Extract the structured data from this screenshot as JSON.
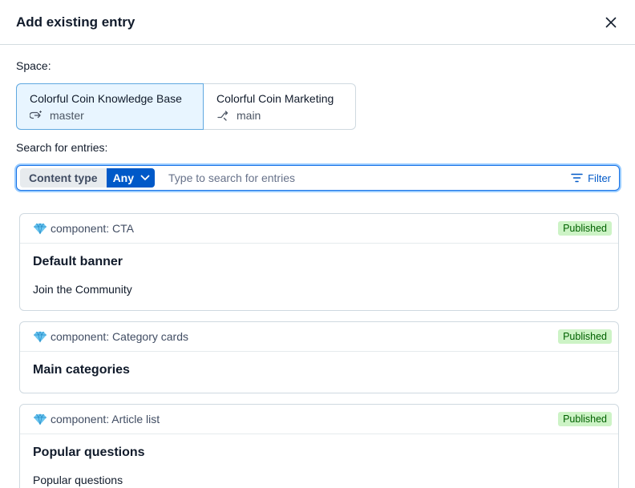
{
  "dialog": {
    "title": "Add existing entry"
  },
  "space": {
    "label": "Space:",
    "tabs": [
      {
        "name": "Colorful Coin Knowledge Base",
        "environment": "master",
        "env_icon": "environment-alias-icon",
        "active": true
      },
      {
        "name": "Colorful Coin Marketing",
        "environment": "main",
        "env_icon": "environment-branch-icon",
        "active": false
      }
    ]
  },
  "search": {
    "label": "Search for entries:",
    "content_type_label": "Content type",
    "content_type_value": "Any",
    "placeholder": "Type to search for entries",
    "filter_label": "Filter"
  },
  "entries": [
    {
      "content_type": "component: CTA",
      "status": "Published",
      "title": "Default banner",
      "description": "Join the Community"
    },
    {
      "content_type": "component: Category cards",
      "status": "Published",
      "title": "Main categories",
      "description": ""
    },
    {
      "content_type": "component: Article list",
      "status": "Published",
      "title": "Popular questions",
      "description": "Popular questions"
    }
  ],
  "colors": {
    "accent": "#0059c8",
    "active_tab_bg": "#e8f5ff",
    "published_bg": "#cdf3c6",
    "published_text": "#006100"
  }
}
